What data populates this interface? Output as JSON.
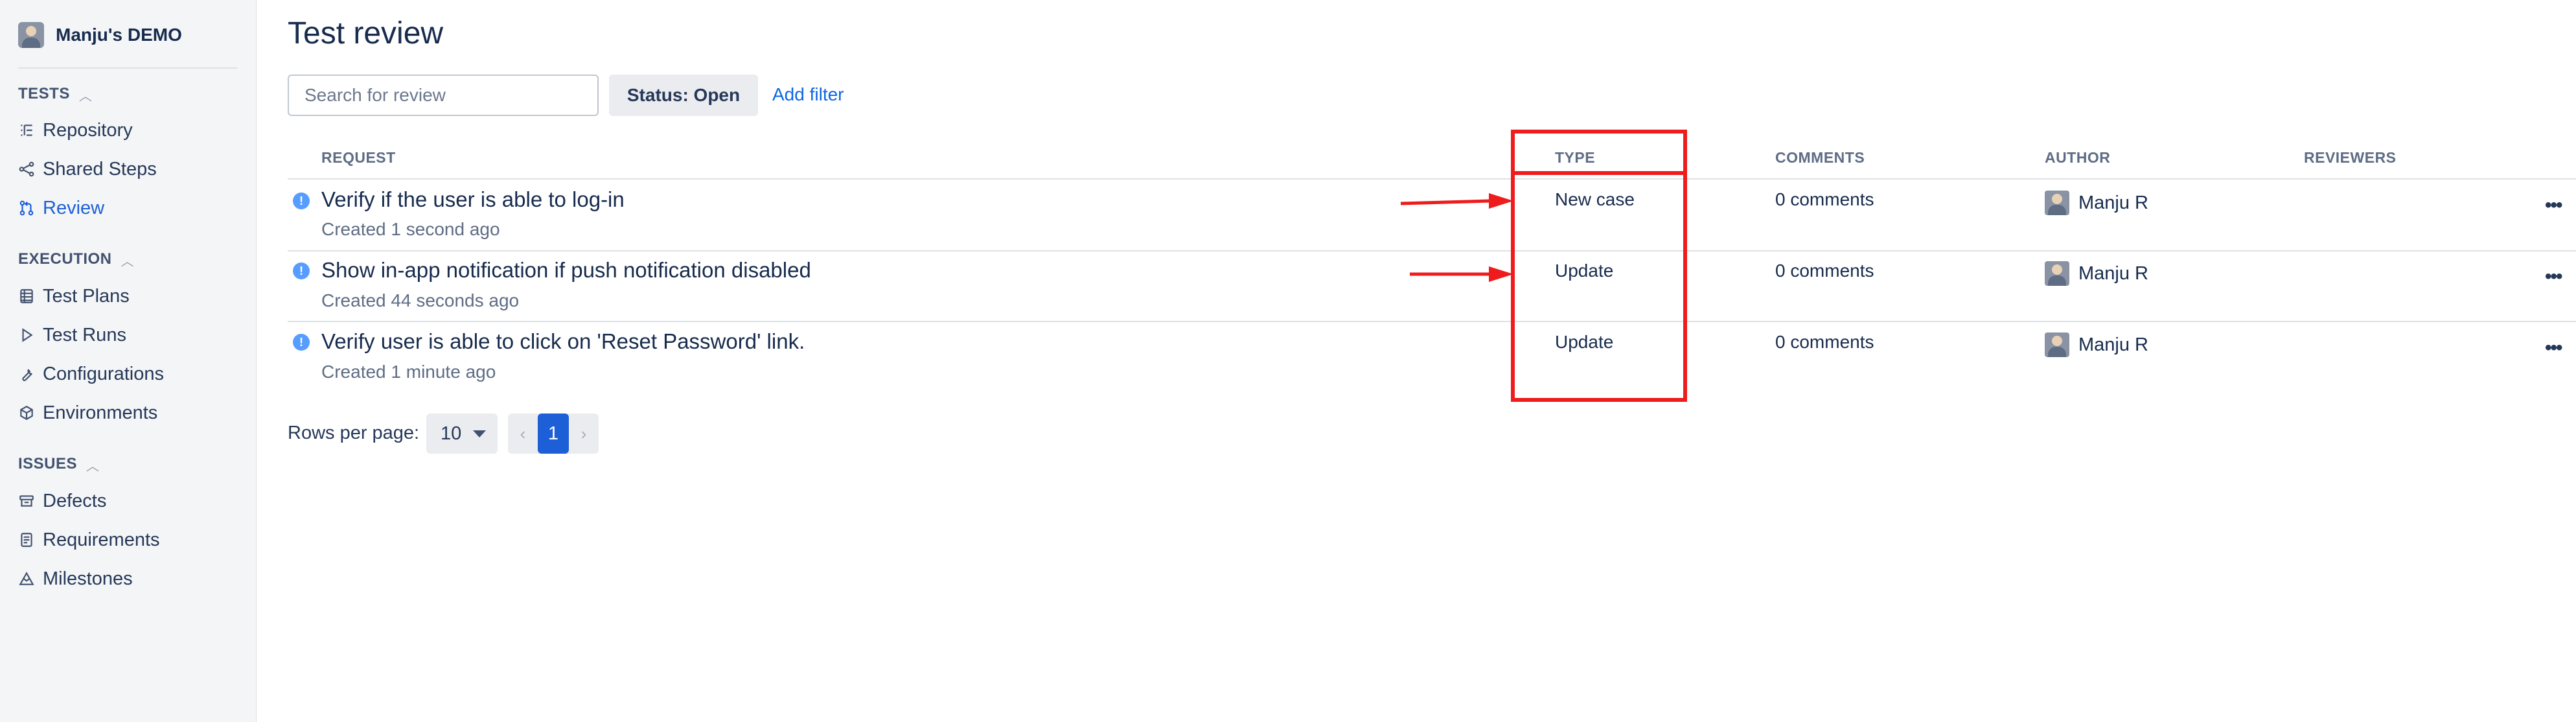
{
  "sidebar": {
    "project_name": "Manju's DEMO",
    "sections": [
      {
        "label": "TESTS",
        "items": [
          {
            "label": "Repository",
            "icon": "list-tree-icon"
          },
          {
            "label": "Shared Steps",
            "icon": "share-nodes-icon"
          },
          {
            "label": "Review",
            "icon": "pull-request-icon",
            "active": true
          }
        ]
      },
      {
        "label": "EXECUTION",
        "items": [
          {
            "label": "Test Plans",
            "icon": "table-icon"
          },
          {
            "label": "Test Runs",
            "icon": "play-icon"
          },
          {
            "label": "Configurations",
            "icon": "wrench-icon"
          },
          {
            "label": "Environments",
            "icon": "cube-icon"
          }
        ]
      },
      {
        "label": "ISSUES",
        "items": [
          {
            "label": "Defects",
            "icon": "bug-icon"
          },
          {
            "label": "Requirements",
            "icon": "document-icon"
          },
          {
            "label": "Milestones",
            "icon": "mountain-icon"
          }
        ]
      }
    ]
  },
  "main": {
    "title": "Test review",
    "search_placeholder": "Search for review",
    "status_filter": "Status: Open",
    "add_filter": "Add filter",
    "columns": {
      "request": "REQUEST",
      "type": "TYPE",
      "comments": "COMMENTS",
      "author": "AUTHOR",
      "reviewers": "REVIEWERS"
    },
    "rows": [
      {
        "title": "Verify if the user is able to log-in",
        "created": "Created 1 second ago",
        "type": "New case",
        "comments": "0 comments",
        "author": "Manju R"
      },
      {
        "title": "Show in-app notification if push notification disabled",
        "created": "Created 44 seconds ago",
        "type": "Update",
        "comments": "0 comments",
        "author": "Manju R"
      },
      {
        "title": "Verify user is able to click on 'Reset Password' link.",
        "created": "Created 1 minute ago",
        "type": "Update",
        "comments": "0 comments",
        "author": "Manju R"
      }
    ],
    "pagination": {
      "rows_label": "Rows per page:",
      "rows_value": "10",
      "prev": "‹",
      "current_page": "1",
      "next": "›"
    }
  },
  "colors": {
    "accent": "#1d5fd6",
    "link": "#0c66e4",
    "annotation": "#ee1c1c",
    "info_icon": "#579dff"
  }
}
